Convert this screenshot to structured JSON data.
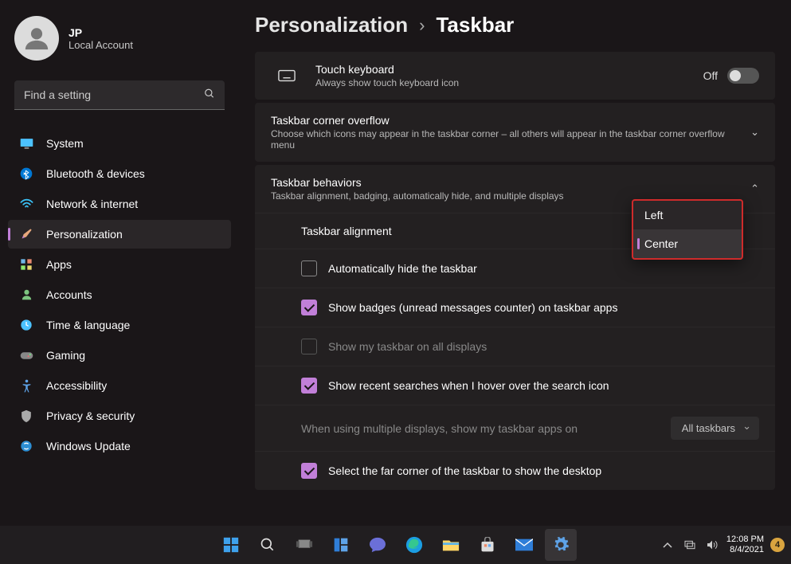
{
  "profile": {
    "initials": "JP",
    "name": "JP",
    "type": "Local Account"
  },
  "search": {
    "placeholder": "Find a setting"
  },
  "nav": {
    "items": [
      {
        "label": "System"
      },
      {
        "label": "Bluetooth & devices"
      },
      {
        "label": "Network & internet"
      },
      {
        "label": "Personalization"
      },
      {
        "label": "Apps"
      },
      {
        "label": "Accounts"
      },
      {
        "label": "Time & language"
      },
      {
        "label": "Gaming"
      },
      {
        "label": "Accessibility"
      },
      {
        "label": "Privacy & security"
      },
      {
        "label": "Windows Update"
      }
    ]
  },
  "breadcrumb": {
    "parent": "Personalization",
    "sep": "›",
    "current": "Taskbar"
  },
  "touchKeyboard": {
    "title": "Touch keyboard",
    "sub": "Always show touch keyboard icon",
    "state": "Off"
  },
  "overflow": {
    "title": "Taskbar corner overflow",
    "sub": "Choose which icons may appear in the taskbar corner – all others will appear in the taskbar corner overflow menu"
  },
  "behaviors": {
    "title": "Taskbar behaviors",
    "sub": "Taskbar alignment, badging, automatically hide, and multiple displays"
  },
  "alignment": {
    "label": "Taskbar alignment",
    "options": [
      "Left",
      "Center"
    ],
    "selected": "Center"
  },
  "opts": {
    "autoHide": "Automatically hide the taskbar",
    "badges": "Show badges (unread messages counter) on taskbar apps",
    "allDisplays": "Show my taskbar on all displays",
    "recentSearch": "Show recent searches when I hover over the search icon",
    "multiDisplayLabel": "When using multiple displays, show my taskbar apps on",
    "multiDisplayValue": "All taskbars",
    "farCorner": "Select the far corner of the taskbar to show the desktop"
  },
  "taskbar": {
    "time": "12:08 PM",
    "date": "8/4/2021",
    "notifCount": "4"
  }
}
